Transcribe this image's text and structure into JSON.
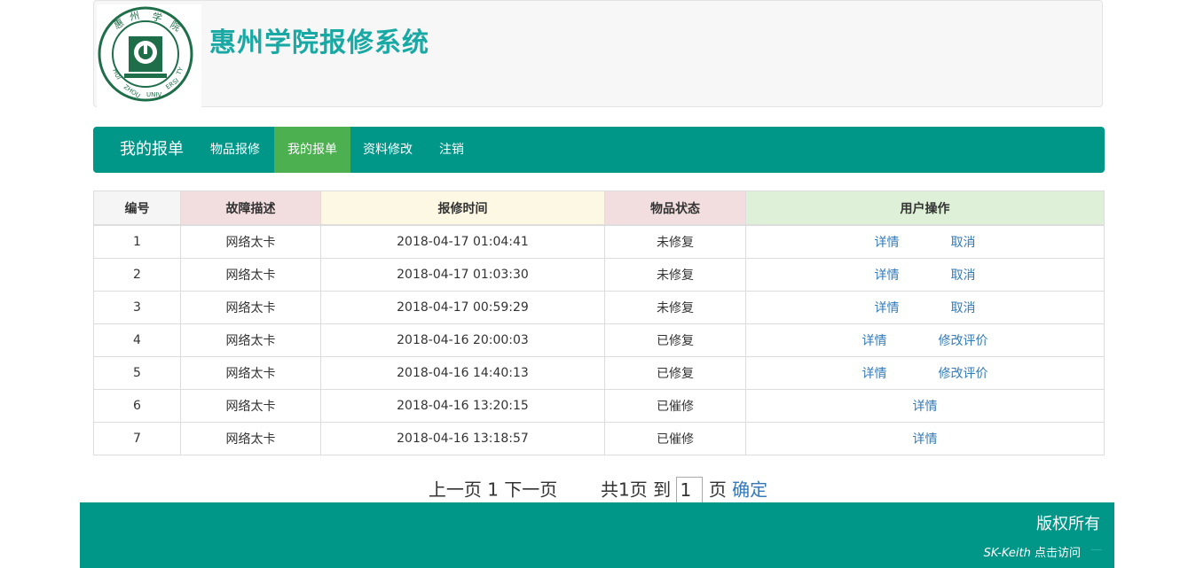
{
  "header": {
    "logo_alt": "惠州学院",
    "logo_text_cn": "惠州学院",
    "logo_text_en": "HUIZHOU UNIVERSITY",
    "title": "惠州学院报修系统"
  },
  "nav": {
    "brand": "我的报单",
    "items": [
      {
        "label": "物品报修"
      },
      {
        "label": "我的报单"
      },
      {
        "label": "资料修改"
      },
      {
        "label": "注销"
      }
    ]
  },
  "table": {
    "headers": [
      "编号",
      "故障描述",
      "报修时间",
      "物品状态",
      "用户操作"
    ],
    "rows": [
      {
        "id": "1",
        "desc": "网络太卡",
        "time": "2018-04-17 01:04:41",
        "status": "未修复",
        "op1": "详情",
        "op2": "取消"
      },
      {
        "id": "2",
        "desc": "网络太卡",
        "time": "2018-04-17 01:03:30",
        "status": "未修复",
        "op1": "详情",
        "op2": "取消"
      },
      {
        "id": "3",
        "desc": "网络太卡",
        "time": "2018-04-17 00:59:29",
        "status": "未修复",
        "op1": "详情",
        "op2": "取消"
      },
      {
        "id": "4",
        "desc": "网络太卡",
        "time": "2018-04-16 20:00:03",
        "status": "已修复",
        "op1": "详情",
        "op2": "修改评价"
      },
      {
        "id": "5",
        "desc": "网络太卡",
        "time": "2018-04-16 14:40:13",
        "status": "已修复",
        "op1": "详情",
        "op2": "修改评价"
      },
      {
        "id": "6",
        "desc": "网络太卡",
        "time": "2018-04-16 13:20:15",
        "status": "已催修",
        "op1": "详情"
      },
      {
        "id": "7",
        "desc": "网络太卡",
        "time": "2018-04-16 13:18:57",
        "status": "已催修",
        "op1": "详情"
      }
    ]
  },
  "pager": {
    "prev": "上一页",
    "current": "1",
    "next": "下一页",
    "total": "共1页",
    "goto": "到",
    "page_value": "1",
    "page_unit": "页",
    "confirm": "确定"
  },
  "footer": {
    "copyright": "版权所有",
    "author": "SK-Keith",
    "visit": "点击访问",
    "dash": "—"
  },
  "colors": {
    "primary": "#009688",
    "active_nav": "#4caf50",
    "title": "#19a9a4",
    "link": "#337ab7"
  }
}
